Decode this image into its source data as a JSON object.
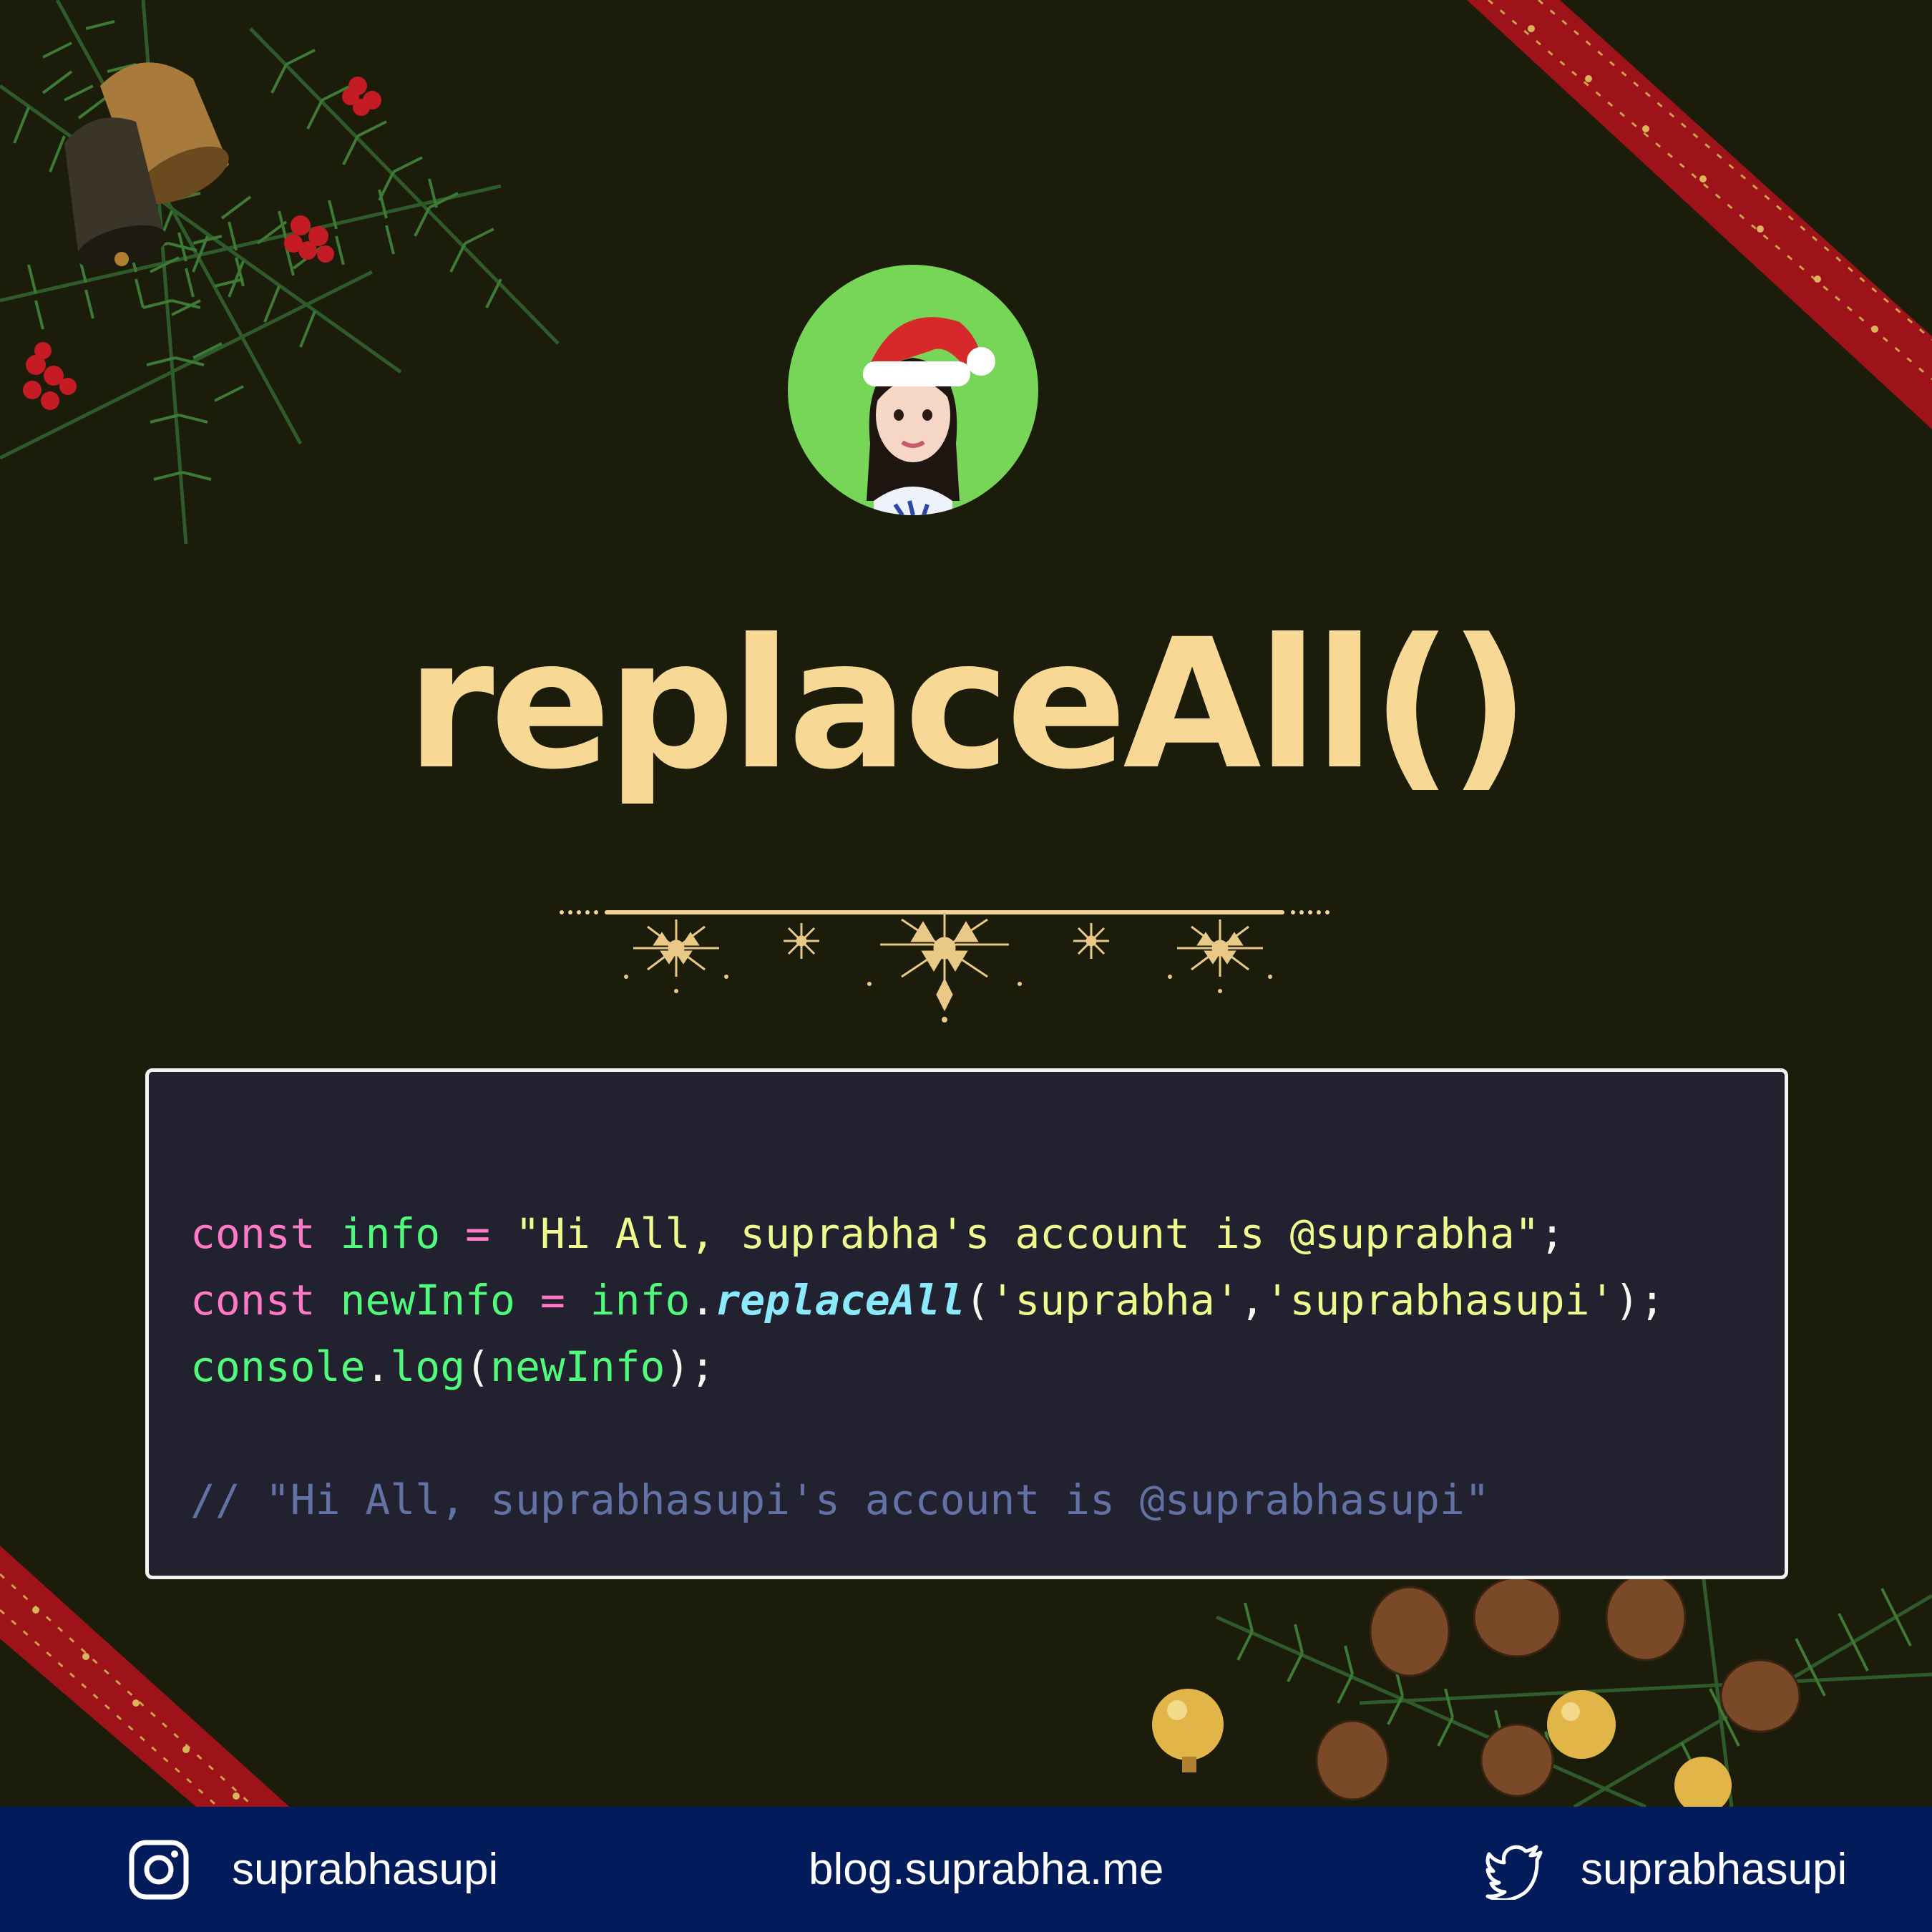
{
  "title": "replaceAll()",
  "avatar": {
    "icon": "avatar-santa-hat-icon"
  },
  "code": {
    "line1": {
      "kw": "const",
      "var": "info",
      "op": "=",
      "str": "\"Hi All, suprabha's account is @suprabha\"",
      "end": ";"
    },
    "line2": {
      "kw": "const",
      "var": "newInfo",
      "op": "=",
      "obj": "info",
      "dot": ".",
      "fn": "replaceAll",
      "open": "(",
      "arg1": "'suprabha'",
      "comma": ",",
      "arg2": "'suprabhasupi'",
      "end": ");"
    },
    "line3": {
      "obj": "console",
      "dot": ".",
      "fn": "log",
      "open": "(",
      "arg": "newInfo",
      "end": ");"
    },
    "comment": "// \"Hi All, suprabhasupi's account is @suprabhasupi\""
  },
  "footer": {
    "instagram_handle": "suprabhasupi",
    "blog_url": "blog.suprabha.me",
    "twitter_handle": "suprabhasupi"
  },
  "colors": {
    "background": "#1b1c0a",
    "title": "#f7d894",
    "avatar_bg": "#77d558",
    "code_bg": "#22212f",
    "footer_bg": "#021b5b"
  }
}
